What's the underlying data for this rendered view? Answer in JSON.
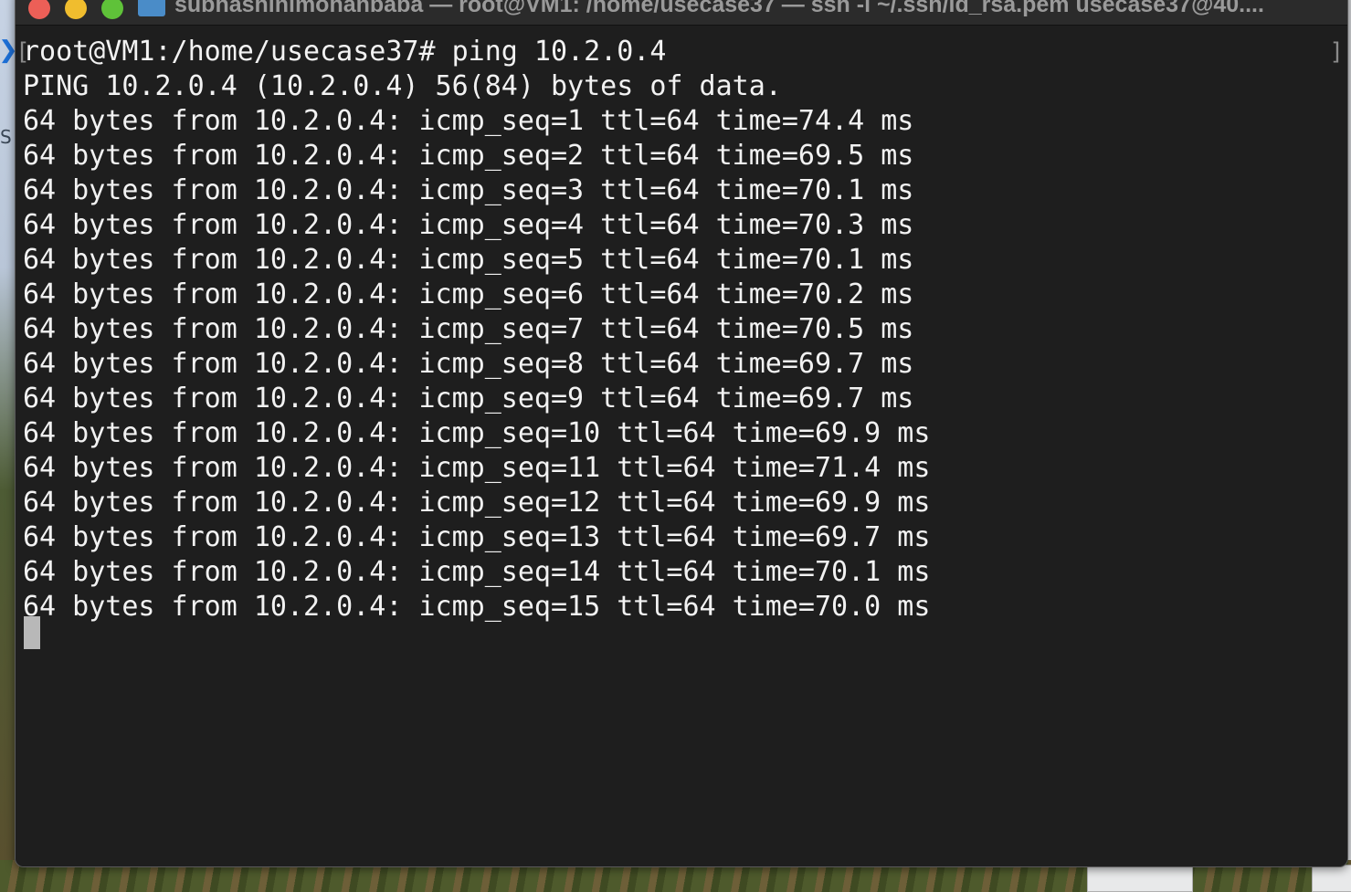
{
  "window": {
    "title": "subhashinimohanbaba — root@VM1: /home/usecase37 — ssh -i ~/.ssh/id_rsa.pem usecase37@40...."
  },
  "terminal": {
    "lines": [
      "root@VM1:/home/usecase37# ping 10.2.0.4",
      "PING 10.2.0.4 (10.2.0.4) 56(84) bytes of data.",
      "64 bytes from 10.2.0.4: icmp_seq=1 ttl=64 time=74.4 ms",
      "64 bytes from 10.2.0.4: icmp_seq=2 ttl=64 time=69.5 ms",
      "64 bytes from 10.2.0.4: icmp_seq=3 ttl=64 time=70.1 ms",
      "64 bytes from 10.2.0.4: icmp_seq=4 ttl=64 time=70.3 ms",
      "64 bytes from 10.2.0.4: icmp_seq=5 ttl=64 time=70.1 ms",
      "64 bytes from 10.2.0.4: icmp_seq=6 ttl=64 time=70.2 ms",
      "64 bytes from 10.2.0.4: icmp_seq=7 ttl=64 time=70.5 ms",
      "64 bytes from 10.2.0.4: icmp_seq=8 ttl=64 time=69.7 ms",
      "64 bytes from 10.2.0.4: icmp_seq=9 ttl=64 time=69.7 ms",
      "64 bytes from 10.2.0.4: icmp_seq=10 ttl=64 time=69.9 ms",
      "64 bytes from 10.2.0.4: icmp_seq=11 ttl=64 time=71.4 ms",
      "64 bytes from 10.2.0.4: icmp_seq=12 ttl=64 time=69.9 ms",
      "64 bytes from 10.2.0.4: icmp_seq=13 ttl=64 time=69.7 ms",
      "64 bytes from 10.2.0.4: icmp_seq=14 ttl=64 time=70.1 ms",
      "64 bytes from 10.2.0.4: icmp_seq=15 ttl=64 time=70.0 ms"
    ]
  },
  "colors": {
    "terminal_background": "#1e1e1e",
    "terminal_text": "#f2f2f2",
    "close_button": "#ec5f57",
    "minimize_button": "#f0bd2e",
    "zoom_button": "#5fc239"
  },
  "icons": {
    "folder": "folder-icon",
    "sidebar": "chevron-right-icon"
  },
  "desktop": {
    "sidebar_letter": "S"
  }
}
